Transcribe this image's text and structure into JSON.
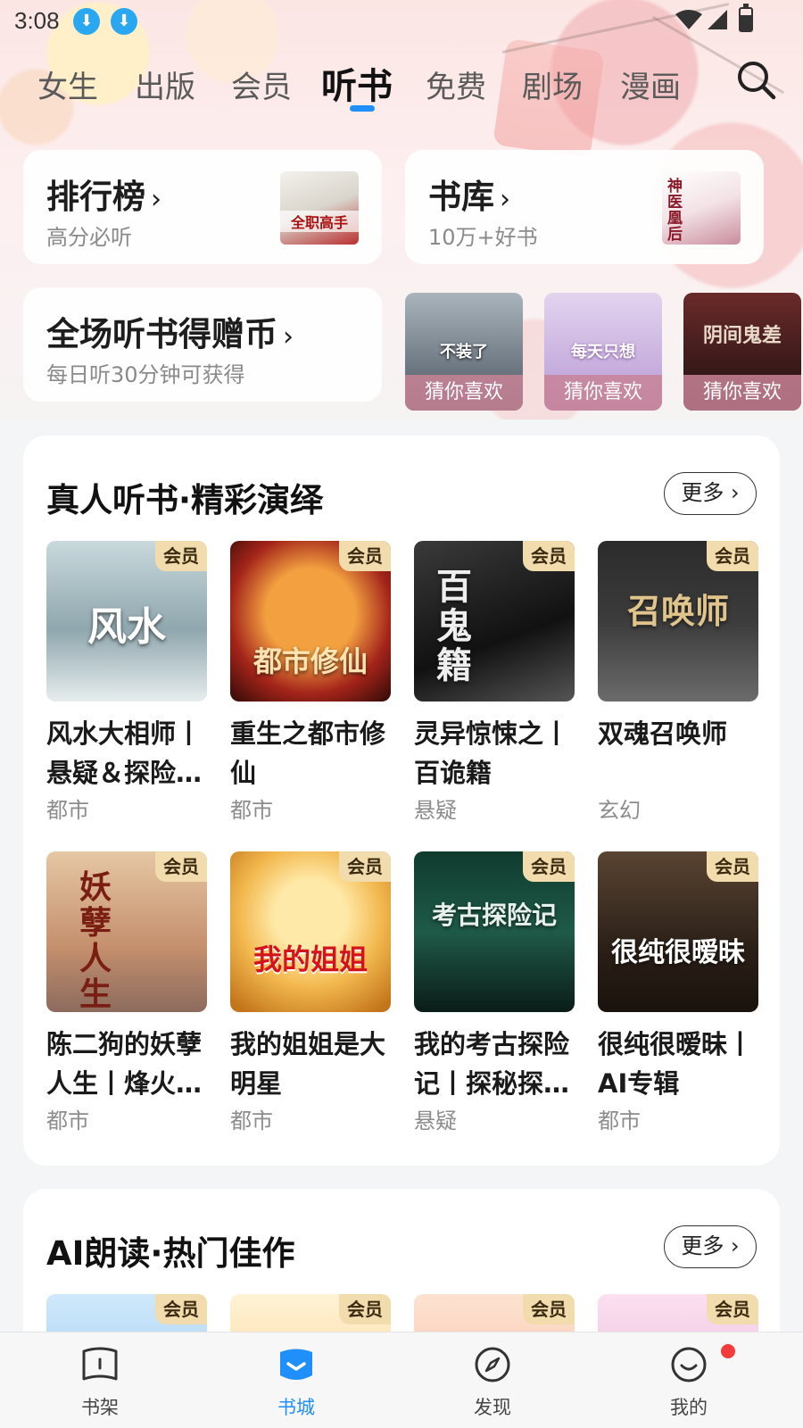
{
  "status_bar": {
    "time": "3:08"
  },
  "tabs": [
    {
      "label": "女生"
    },
    {
      "label": "出版"
    },
    {
      "label": "会员"
    },
    {
      "label": "听书",
      "active": true
    },
    {
      "label": "免费"
    },
    {
      "label": "剧场"
    },
    {
      "label": "漫画"
    }
  ],
  "quick_cards": {
    "ranking": {
      "title": "排行榜",
      "sub": "高分必听",
      "cover_text": "全职高手"
    },
    "library": {
      "title": "书库",
      "sub": "10万+好书",
      "cover_text": "神医凰后"
    },
    "coins": {
      "title": "全场听书得赠币",
      "sub": "每日听30分钟可获得"
    }
  },
  "guess_label": "猜你喜欢",
  "guess_covers": [
    "不装了",
    "每天只想",
    "阴间鬼差"
  ],
  "chevron": "›",
  "section1": {
    "title": "真人听书·精彩演绎",
    "more": "更多",
    "books": [
      {
        "name": "风水大相师丨悬疑＆探险…",
        "cat": "都市",
        "badge": "会员",
        "cover_text": "风水"
      },
      {
        "name": "重生之都市修仙",
        "cat": "都市",
        "badge": "会员",
        "cover_text": "都市修仙"
      },
      {
        "name": "灵异惊悚之丨百诡籍",
        "cat": "悬疑",
        "badge": "会员",
        "cover_text": "百鬼籍"
      },
      {
        "name": "双魂召唤师",
        "cat": "玄幻",
        "badge": "会员",
        "cover_text": "召唤师"
      },
      {
        "name": "陈二狗的妖孽人生丨烽火…",
        "cat": "都市",
        "badge": "会员",
        "cover_text": "妖孽人生"
      },
      {
        "name": "我的姐姐是大明星",
        "cat": "都市",
        "badge": "会员",
        "cover_text": "我的姐姐"
      },
      {
        "name": "我的考古探险记丨探秘探…",
        "cat": "悬疑",
        "badge": "会员",
        "cover_text": "考古探险记"
      },
      {
        "name": "很纯很暧昧丨AI专辑",
        "cat": "都市",
        "badge": "会员",
        "cover_text": "很纯很暧昧"
      }
    ]
  },
  "section2": {
    "title": "AI朗读·热门佳作",
    "more": "更多",
    "badge": "会员"
  },
  "bottom_nav": [
    {
      "label": "书架",
      "icon": "bookshelf-icon"
    },
    {
      "label": "书城",
      "icon": "bookstore-icon",
      "active": true
    },
    {
      "label": "发现",
      "icon": "discover-icon"
    },
    {
      "label": "我的",
      "icon": "profile-icon"
    }
  ],
  "colors": {
    "accent": "#1e8ffb",
    "badge_bg": "#f2dcae",
    "notification": "#f23b3b"
  }
}
